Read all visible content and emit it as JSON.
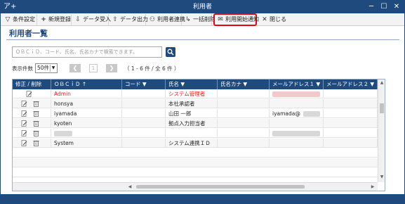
{
  "window": {
    "title": "利用者",
    "app_icon": "ア+"
  },
  "toolbar": {
    "filter": "条件設定",
    "new": "新規登録",
    "import": "データ受入",
    "export": "データ出力",
    "link": "利用者連携",
    "bulk_delete": "一括削除",
    "notify": "利用開始通知",
    "close": "閉じる"
  },
  "page": {
    "title": "利用者一覧"
  },
  "search": {
    "placeholder": "ＯＢＣｉＤ、コード、氏名、氏名カナで検索できます。"
  },
  "pager": {
    "count_label": "表示件数",
    "count_value": "50件",
    "page": "1",
    "info": "（ 1 - 6 件 / 全 6 件 ）"
  },
  "grid": {
    "columns": [
      "修正 / 削除",
      "ＯＢＣｉＤ ↑",
      "コード ▼",
      "氏名 ▼",
      "氏名カナ ▼",
      "メールアドレス１ ▼",
      "メールアドレス２ ▼"
    ],
    "rows": [
      {
        "obcid": "Admin",
        "name": "システム管理者",
        "email": ""
      },
      {
        "obcid": "honsya",
        "name": "本社承認者",
        "email": ""
      },
      {
        "obcid": "iyamada",
        "name": "山田 一郎",
        "email": "iyamada@"
      },
      {
        "obcid": "kyoten",
        "name": "拠点入力担当者",
        "email": ""
      },
      {
        "obcid": "",
        "name": "",
        "email": ""
      },
      {
        "obcid": "System",
        "name": "システム連携ＩＤ",
        "email": ""
      }
    ]
  },
  "colors": {
    "brand": "#1e4a7e",
    "highlight": "#e30613",
    "admin_text": "#e02020"
  }
}
